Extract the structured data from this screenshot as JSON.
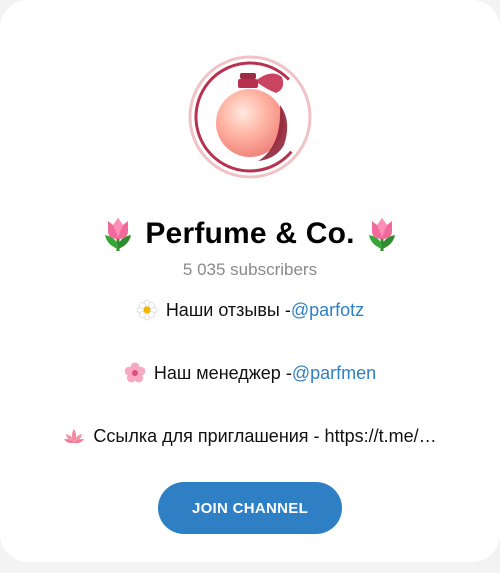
{
  "channel": {
    "title": "Perfume & Co.",
    "title_left_emoji": "tulip",
    "title_right_emoji": "tulip",
    "subscribers": "5 035 subscribers"
  },
  "description": [
    {
      "icon": "daisy-icon",
      "text": "Наши отзывы - ",
      "link": "@parfotz"
    },
    {
      "icon": "cherry-blossom-icon",
      "text": "Наш менеджер - ",
      "link": "@parfmen"
    },
    {
      "icon": "lotus-icon",
      "text": "Ссылка для приглашения - https://t.me/…",
      "link": ""
    }
  ],
  "actions": {
    "join_label": "JOIN CHANNEL"
  },
  "colors": {
    "accent": "#2f7fc4",
    "muted": "#8a8a8a",
    "avatar_ring": "#b8324f"
  }
}
